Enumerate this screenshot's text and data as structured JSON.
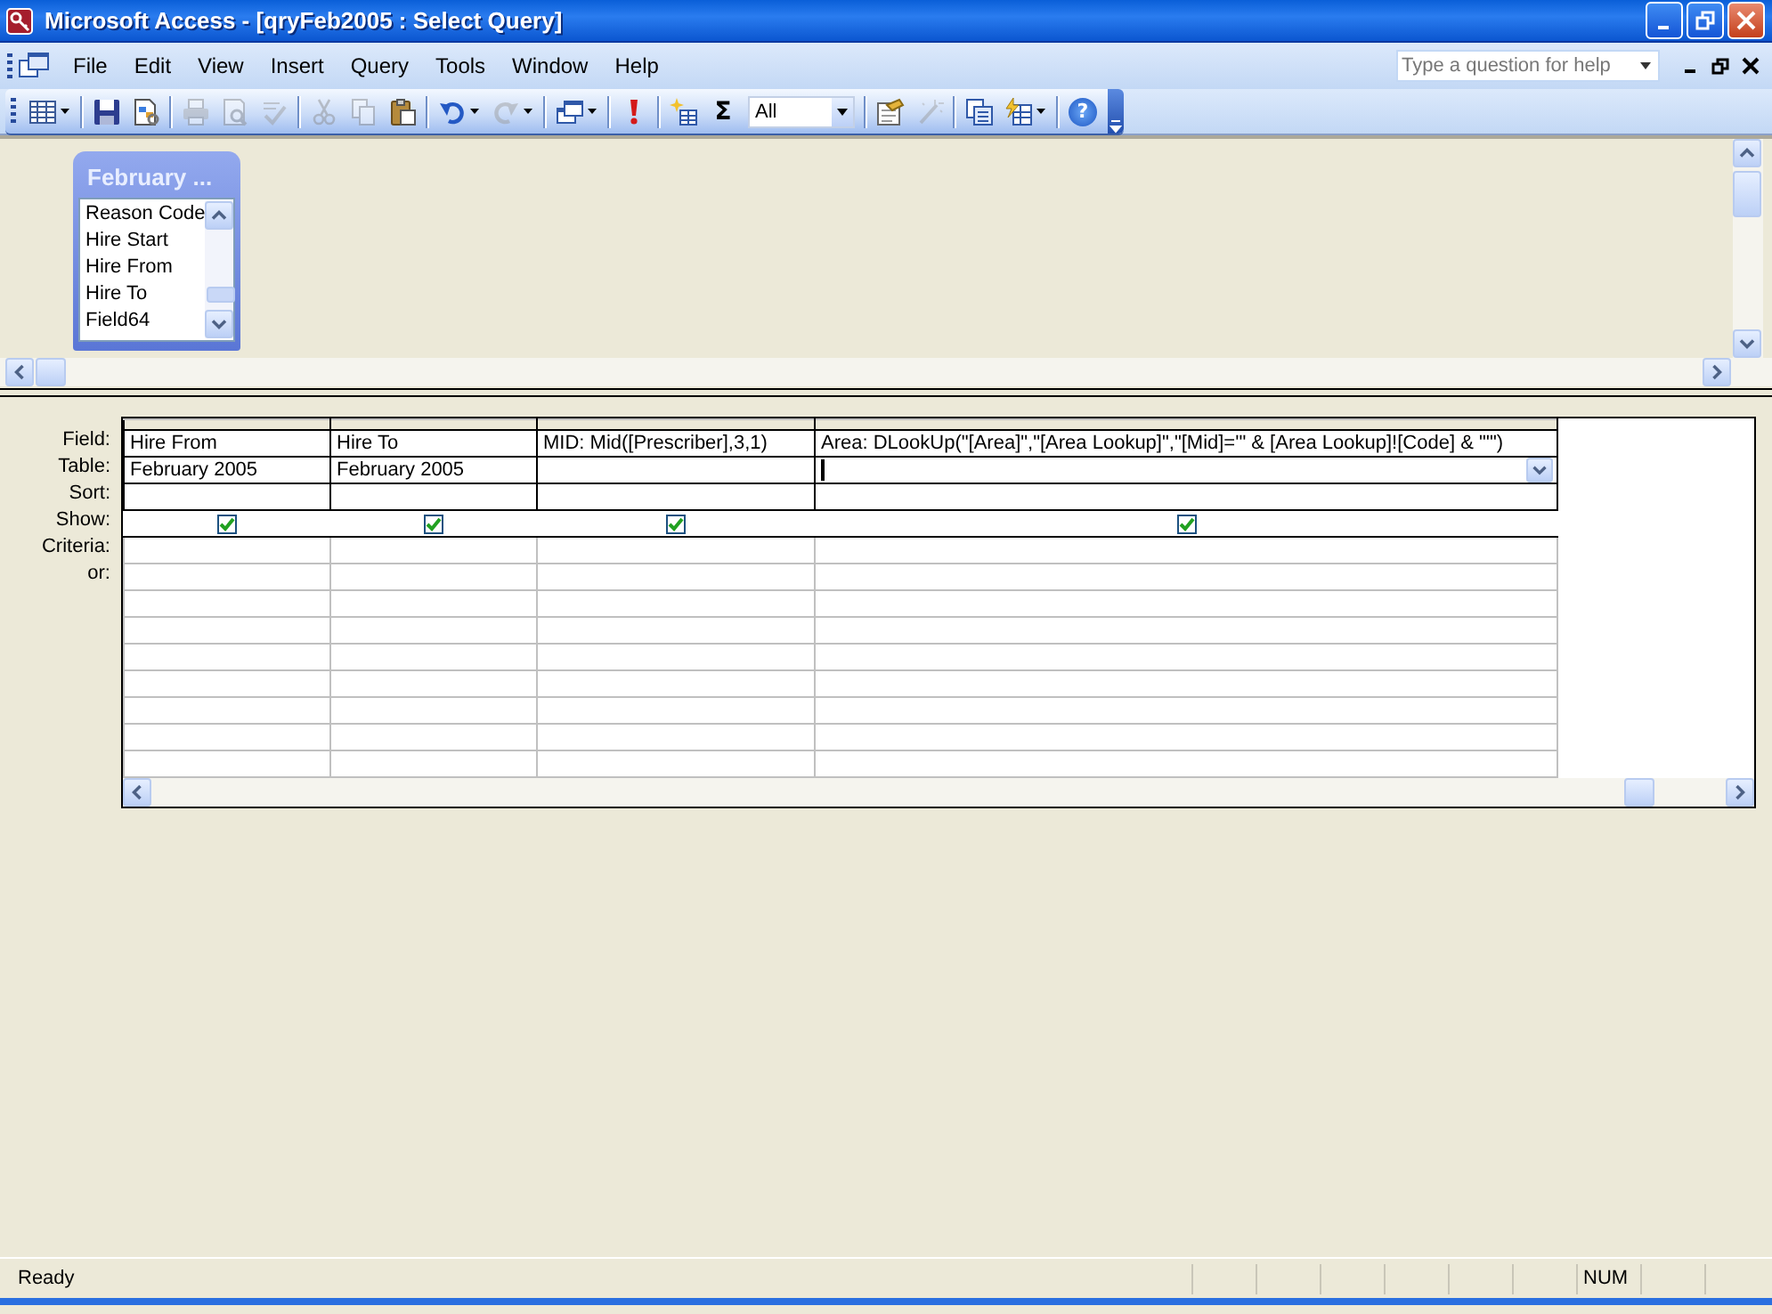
{
  "window": {
    "title": "Microsoft Access - [qryFeb2005 : Select Query]"
  },
  "menu": [
    {
      "label": "File"
    },
    {
      "label": "Edit"
    },
    {
      "label": "View"
    },
    {
      "label": "Insert"
    },
    {
      "label": "Query"
    },
    {
      "label": "Tools"
    },
    {
      "label": "Window"
    },
    {
      "label": "Help"
    }
  ],
  "help_box": {
    "placeholder": "Type a question for help"
  },
  "toolbar": [
    {
      "kind": "datasheet",
      "disabled": false,
      "dropdown": true
    },
    {
      "kind": "separator"
    },
    {
      "kind": "save",
      "disabled": false,
      "dropdown": false
    },
    {
      "kind": "file-search",
      "disabled": false,
      "dropdown": false
    },
    {
      "kind": "separator"
    },
    {
      "kind": "print",
      "disabled": true,
      "dropdown": false
    },
    {
      "kind": "preview",
      "disabled": true,
      "dropdown": false
    },
    {
      "kind": "spelling",
      "disabled": true,
      "dropdown": false
    },
    {
      "kind": "separator"
    },
    {
      "kind": "cut",
      "disabled": true,
      "dropdown": false
    },
    {
      "kind": "copy",
      "disabled": true,
      "dropdown": false
    },
    {
      "kind": "paste",
      "disabled": false,
      "dropdown": false
    },
    {
      "kind": "separator"
    },
    {
      "kind": "undo",
      "disabled": false,
      "dropdown": true
    },
    {
      "kind": "redo",
      "disabled": true,
      "dropdown": true
    },
    {
      "kind": "separator"
    },
    {
      "kind": "query-type",
      "disabled": false,
      "dropdown": true
    },
    {
      "kind": "separator"
    },
    {
      "kind": "run",
      "disabled": false,
      "dropdown": false
    },
    {
      "kind": "separator"
    },
    {
      "kind": "show-table",
      "disabled": false,
      "dropdown": false
    },
    {
      "kind": "totals",
      "label": "Σ",
      "disabled": false,
      "dropdown": false
    },
    {
      "kind": "combo",
      "value": "All"
    },
    {
      "kind": "separator"
    },
    {
      "kind": "properties",
      "disabled": false,
      "dropdown": false
    },
    {
      "kind": "builder",
      "disabled": true,
      "dropdown": false
    },
    {
      "kind": "separator"
    },
    {
      "kind": "database-window",
      "disabled": false,
      "dropdown": false
    },
    {
      "kind": "new-object",
      "disabled": false,
      "dropdown": true
    },
    {
      "kind": "separator"
    },
    {
      "kind": "help",
      "label": "?",
      "disabled": false,
      "dropdown": false
    }
  ],
  "field_list": {
    "title": "February ...",
    "fields": [
      "Reason Code",
      "Hire Start",
      "Hire From",
      "Hire To",
      "Field64"
    ]
  },
  "grid": {
    "row_labels": [
      "Field:",
      "Table:",
      "Sort:",
      "Show:",
      "Criteria:",
      "or:"
    ],
    "columns": [
      {
        "field": "Hire From",
        "table": "February 2005",
        "show": true,
        "focused": false
      },
      {
        "field": "Hire To",
        "table": "February 2005",
        "show": true,
        "focused": false
      },
      {
        "field": "MID: Mid([Prescriber],3,1)",
        "show": true,
        "focused": false
      },
      {
        "field": "Area: DLookUp(\"[Area]\",\"[Area Lookup]\",\"[Mid]='\" & [Area Lookup]![Code] & \"'\")",
        "show": true,
        "focused": true
      }
    ]
  },
  "status_bar": {
    "message": "Ready",
    "indicators": [
      "NUM"
    ]
  }
}
